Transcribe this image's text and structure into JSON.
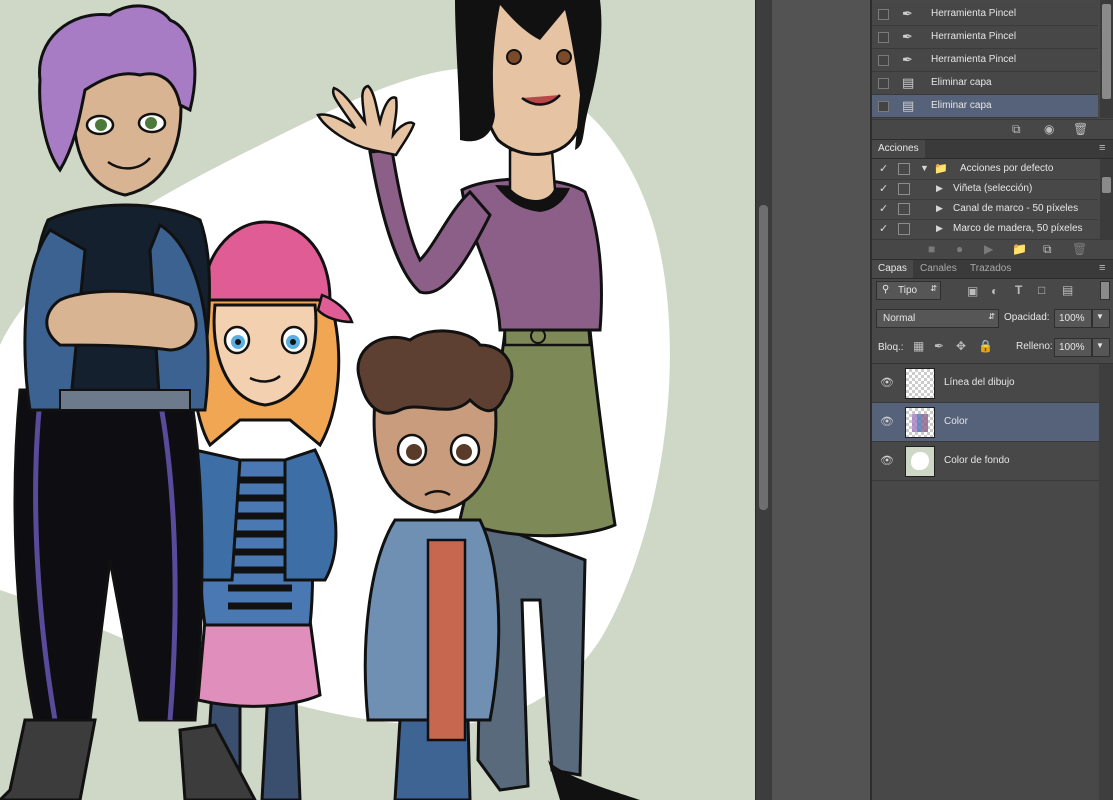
{
  "history": {
    "items": [
      {
        "label": "Herramienta Pincel",
        "icon": "brush-icon"
      },
      {
        "label": "Herramienta Pincel",
        "icon": "brush-icon"
      },
      {
        "label": "Herramienta Pincel",
        "icon": "brush-icon"
      },
      {
        "label": "Eliminar capa",
        "icon": "document-icon"
      },
      {
        "label": "Eliminar capa",
        "icon": "document-icon",
        "selected": true
      }
    ]
  },
  "actions": {
    "tab": "Acciones",
    "rows": [
      {
        "label": "Acciones por defecto",
        "expanded": true,
        "is_set": true
      },
      {
        "label": "Viñeta (selección)"
      },
      {
        "label": "Canal de marco - 50 píxeles"
      },
      {
        "label": "Marco de madera, 50 píxeles"
      }
    ]
  },
  "layers_panel": {
    "tabs": [
      "Capas",
      "Canales",
      "Trazados"
    ],
    "active_tab": "Capas",
    "filter_label": "Tipo",
    "blend_mode": "Normal",
    "opacity_label": "Opacidad:",
    "opacity_value": "100%",
    "lock_label": "Bloq.:",
    "fill_label": "Relleno:",
    "fill_value": "100%",
    "layers": [
      {
        "name": "Línea del dibujo",
        "visible": true
      },
      {
        "name": "Color",
        "visible": true,
        "selected": true
      },
      {
        "name": "Color de fondo",
        "visible": true
      }
    ]
  },
  "colors": {
    "canvas_bg": "#cfd8c6",
    "panel_bg": "#484848",
    "selected_row": "#56617a"
  }
}
